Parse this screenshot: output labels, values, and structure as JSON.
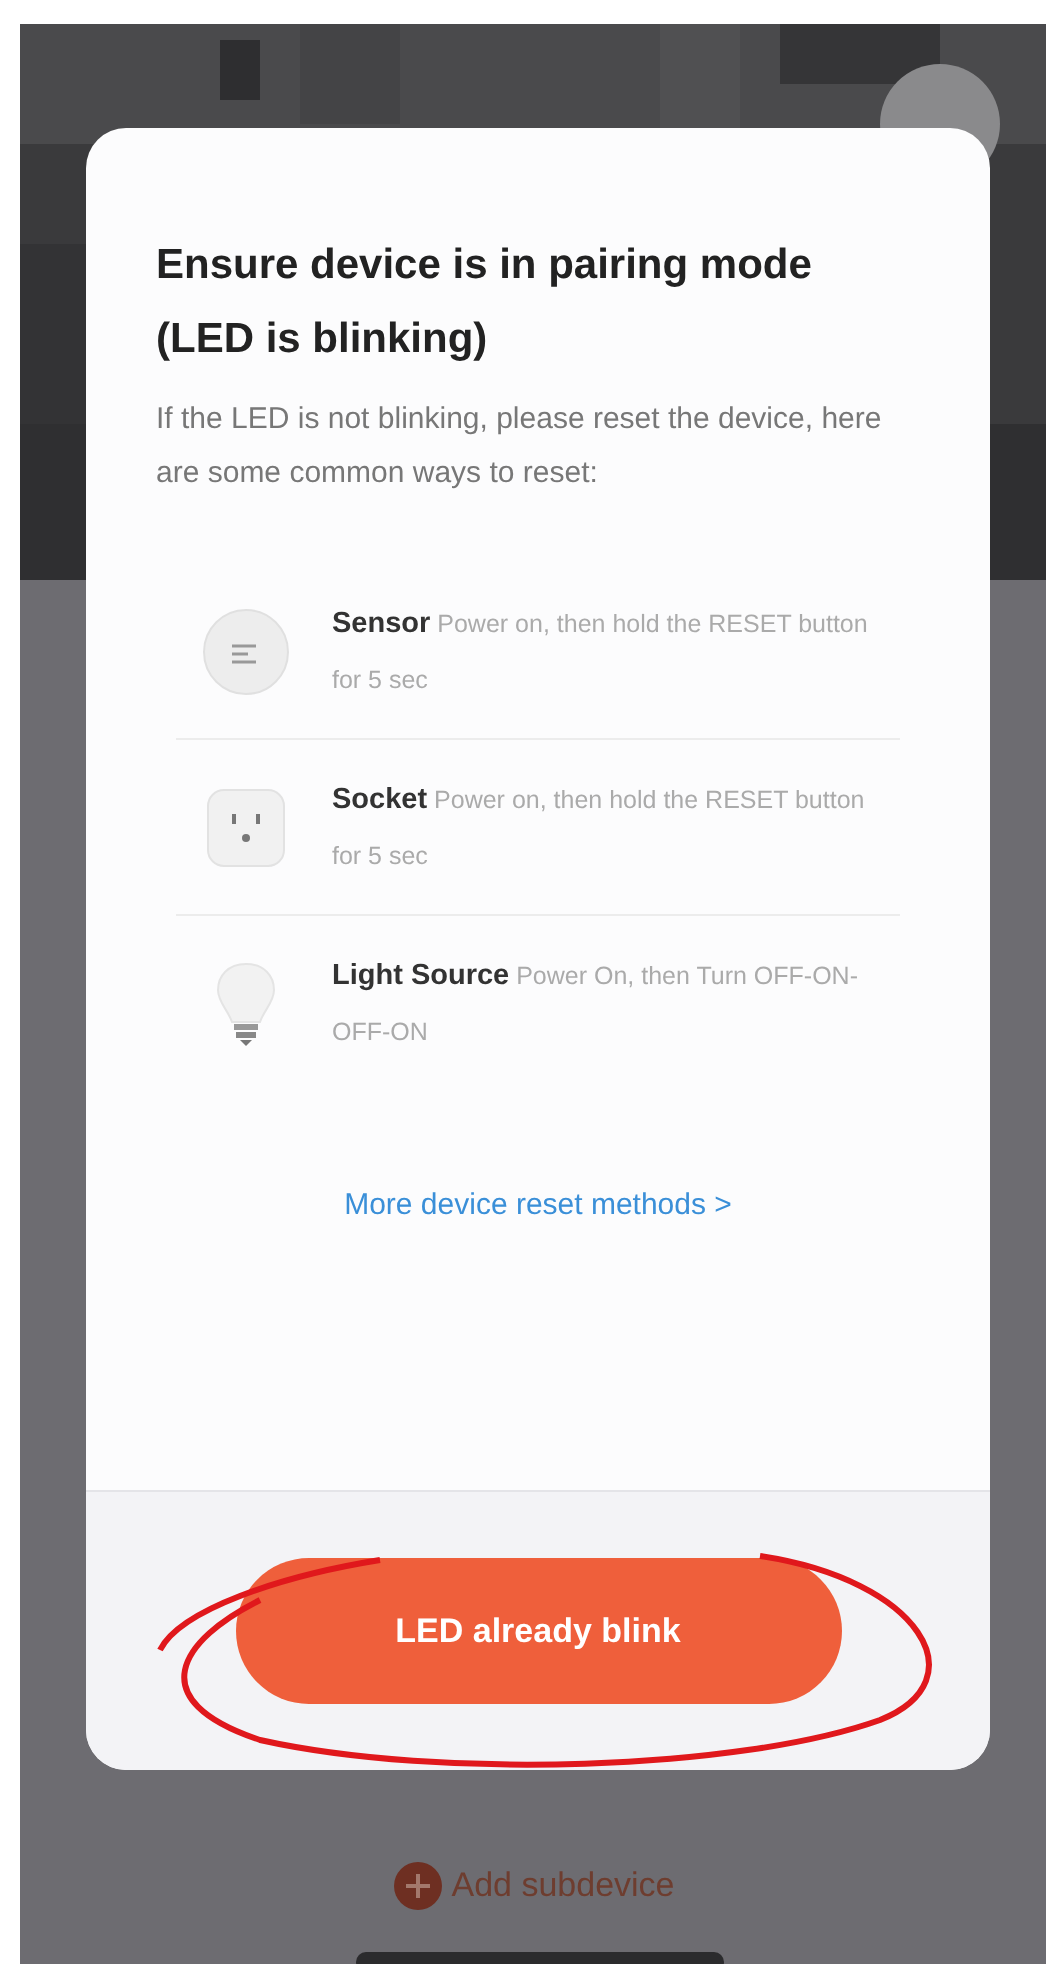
{
  "dialog": {
    "title": "Ensure device is in pairing mode (LED is blinking)",
    "description": "If the LED is not blinking, please reset the device, here are some common ways to reset:",
    "methods": [
      {
        "kind": "sensor",
        "text": "**Sensor** Power on, then hold the RESET button for 5 sec"
      },
      {
        "kind": "socket",
        "text": "**Socket** Power on, then hold the RESET button for 5 sec"
      },
      {
        "kind": "bulb",
        "text": "**Light Source** Power On, then Turn OFF-ON-OFF-ON"
      }
    ],
    "more_link": "More device reset methods >",
    "confirm_button": "LED already blink"
  },
  "background": {
    "add_subdevice": "Add subdevice"
  }
}
